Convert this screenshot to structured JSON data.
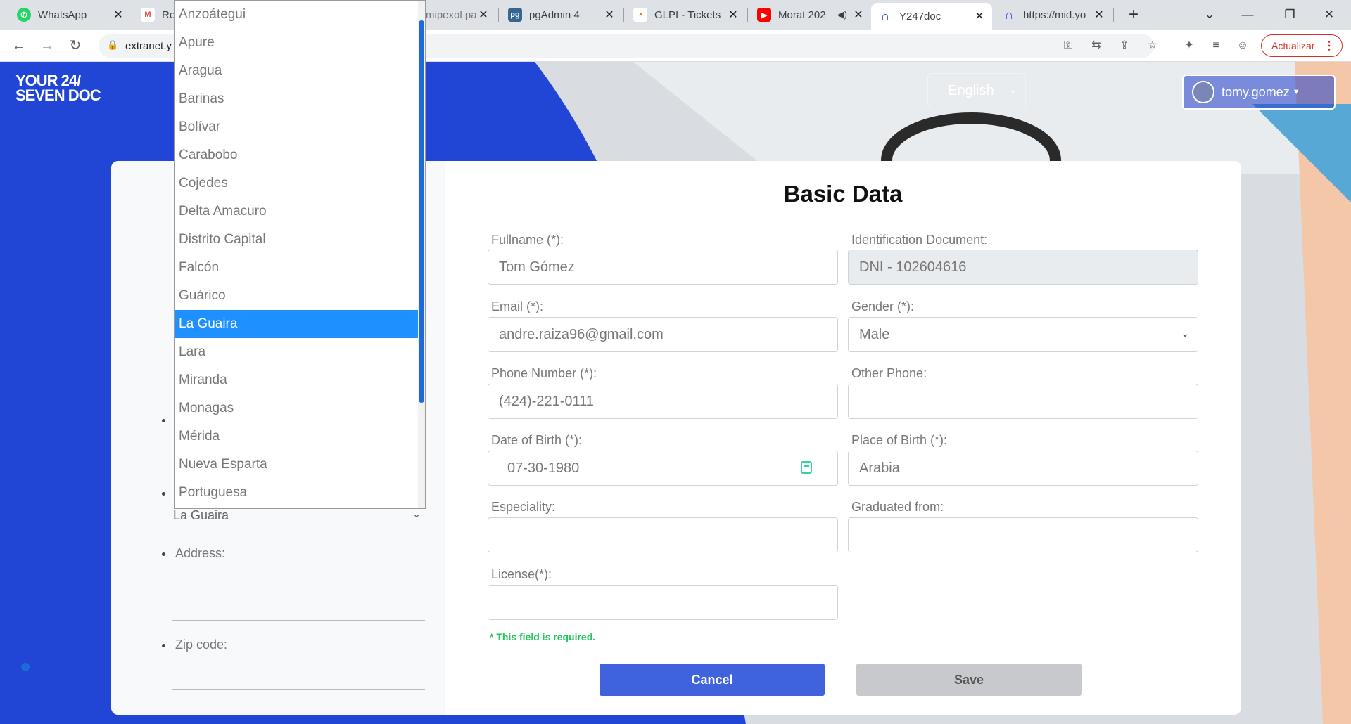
{
  "browser": {
    "tabs": [
      {
        "title": "WhatsApp",
        "icon": "whatsapp-icon",
        "color": "#25d366"
      },
      {
        "title": "Re",
        "icon": "gmail-icon",
        "color": "#ea4335"
      },
      {
        "title": "mipexol pa",
        "icon": "page-icon",
        "color": "#9aa0a6"
      },
      {
        "title": "pgAdmin 4",
        "icon": "pgadmin-icon",
        "color": "#336791"
      },
      {
        "title": "GLPI - Tickets",
        "icon": "glpi-icon",
        "color": "#fbbc05"
      },
      {
        "title": "Morat 202",
        "icon": "youtube-icon",
        "color": "#ff0000"
      },
      {
        "title": "Y247doc",
        "icon": "y247doc-icon",
        "color": "#3b5bdb"
      },
      {
        "title": "https://mid.yo",
        "icon": "y247doc-icon",
        "color": "#3b5bdb"
      }
    ],
    "new_tab": "+",
    "url": "extranet.y",
    "update_label": "Actualizar"
  },
  "header": {
    "logo_line1": "YOUR 24/",
    "logo_line2": "SEVEN DOC",
    "language": "English",
    "username": "tomy.gomez"
  },
  "left_panel": {
    "state_value": "La Guaira",
    "address_label": "Address:",
    "zip_label": "Zip code:"
  },
  "dropdown": {
    "options": [
      "Anzoátegui",
      "Apure",
      "Aragua",
      "Barinas",
      "Bolívar",
      "Carabobo",
      "Cojedes",
      "Delta Amacuro",
      "Distrito Capital",
      "Falcón",
      "Guárico",
      "La Guaira",
      "Lara",
      "Miranda",
      "Monagas",
      "Mérida",
      "Nueva Esparta",
      "Portuguesa"
    ],
    "selected": "La Guaira"
  },
  "form": {
    "title": "Basic Data",
    "fullname_label": "Fullname (*):",
    "fullname_value": "Tom Gómez",
    "id_label": "Identification Document:",
    "id_value": "DNI - 102604616",
    "email_label": "Email (*):",
    "email_value": "andre.raiza96@gmail.com",
    "gender_label": "Gender (*):",
    "gender_value": "Male",
    "phone_label": "Phone Number (*):",
    "phone_value": "(424)-221-0111",
    "other_phone_label": "Other Phone:",
    "other_phone_value": "",
    "dob_label": "Date of Birth (*):",
    "dob_value": "07-30-1980",
    "pob_label": "Place of Birth (*):",
    "pob_value": "Arabia",
    "speciality_label": "Especiality:",
    "graduated_label": "Graduated from:",
    "license_label": "License(*):",
    "license_error": "* This field is required.",
    "cancel_label": "Cancel",
    "save_label": "Save"
  },
  "colors": {
    "brand_blue": "#2146d6",
    "selection": "#1e90ff",
    "error_green": "#22c55e"
  }
}
